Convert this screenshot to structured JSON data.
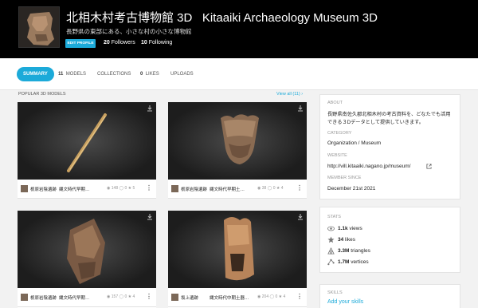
{
  "header": {
    "title_ja": "北相木村考古博物館 3D",
    "title_en": "Kitaaiki Archaeology Museum 3D",
    "subtitle": "長野県の東部にある、小さな村の小さな博物館",
    "edit_label": "EDIT PROFILE",
    "followers_count": "20",
    "followers_label": "Followers",
    "following_count": "10",
    "following_label": "Following"
  },
  "tabs": [
    {
      "count": "",
      "label": "SUMMARY"
    },
    {
      "count": "11",
      "label": "MODELS"
    },
    {
      "count": "",
      "label": "COLLECTIONS"
    },
    {
      "count": "0",
      "label": "LIKES"
    },
    {
      "count": "",
      "label": "UPLOADS"
    }
  ],
  "section": {
    "title": "POPULAR 3D MODELS",
    "view_all": "View all (11) ›"
  },
  "cards": [
    {
      "author": "栃原岩陰遺跡",
      "name": "縄文時代早期…",
      "stats": "◉ 148  ◯ 0  ★ 5"
    },
    {
      "author": "栃原岩陰遺跡",
      "name": "縄文時代早期土…",
      "stats": "◉ 38  ◯ 0  ★ 4"
    },
    {
      "author": "栃原岩陰遺跡",
      "name": "縄文時代早期…",
      "stats": "◉ 157  ◯ 0  ★ 4"
    },
    {
      "author": "坂上遺跡",
      "name": "縄文時代中期土器…",
      "stats": "◉ 204  ◯ 0  ★ 4"
    }
  ],
  "sidebar": {
    "about_label": "ABOUT",
    "about_text": "長野県南佐久郡北相木村の考古資料を、どなたでも活用できる３Dデータとして提供していきます。",
    "category_label": "CATEGORY",
    "category_value": "Organization / Museum",
    "website_label": "WEBSITE",
    "website_value": "http://vill.kitaaiki.nagano.jp/museum/",
    "member_label": "MEMBER SINCE",
    "member_value": "December 21st 2021",
    "stats_label": "STATS",
    "stats": [
      {
        "value": "1.1k",
        "label": "views",
        "icon": "eye-icon"
      },
      {
        "value": "34",
        "label": "likes",
        "icon": "star-icon"
      },
      {
        "value": "3.3M",
        "label": "triangles",
        "icon": "triangles-icon"
      },
      {
        "value": "1.7M",
        "label": "vertices",
        "icon": "vertices-icon"
      }
    ],
    "skills_label": "SKILLS",
    "skills_link": "Add your skills"
  },
  "colors": {
    "accent": "#1caad9",
    "header_bg": "#000000",
    "page_bg": "#f2f2f2"
  }
}
